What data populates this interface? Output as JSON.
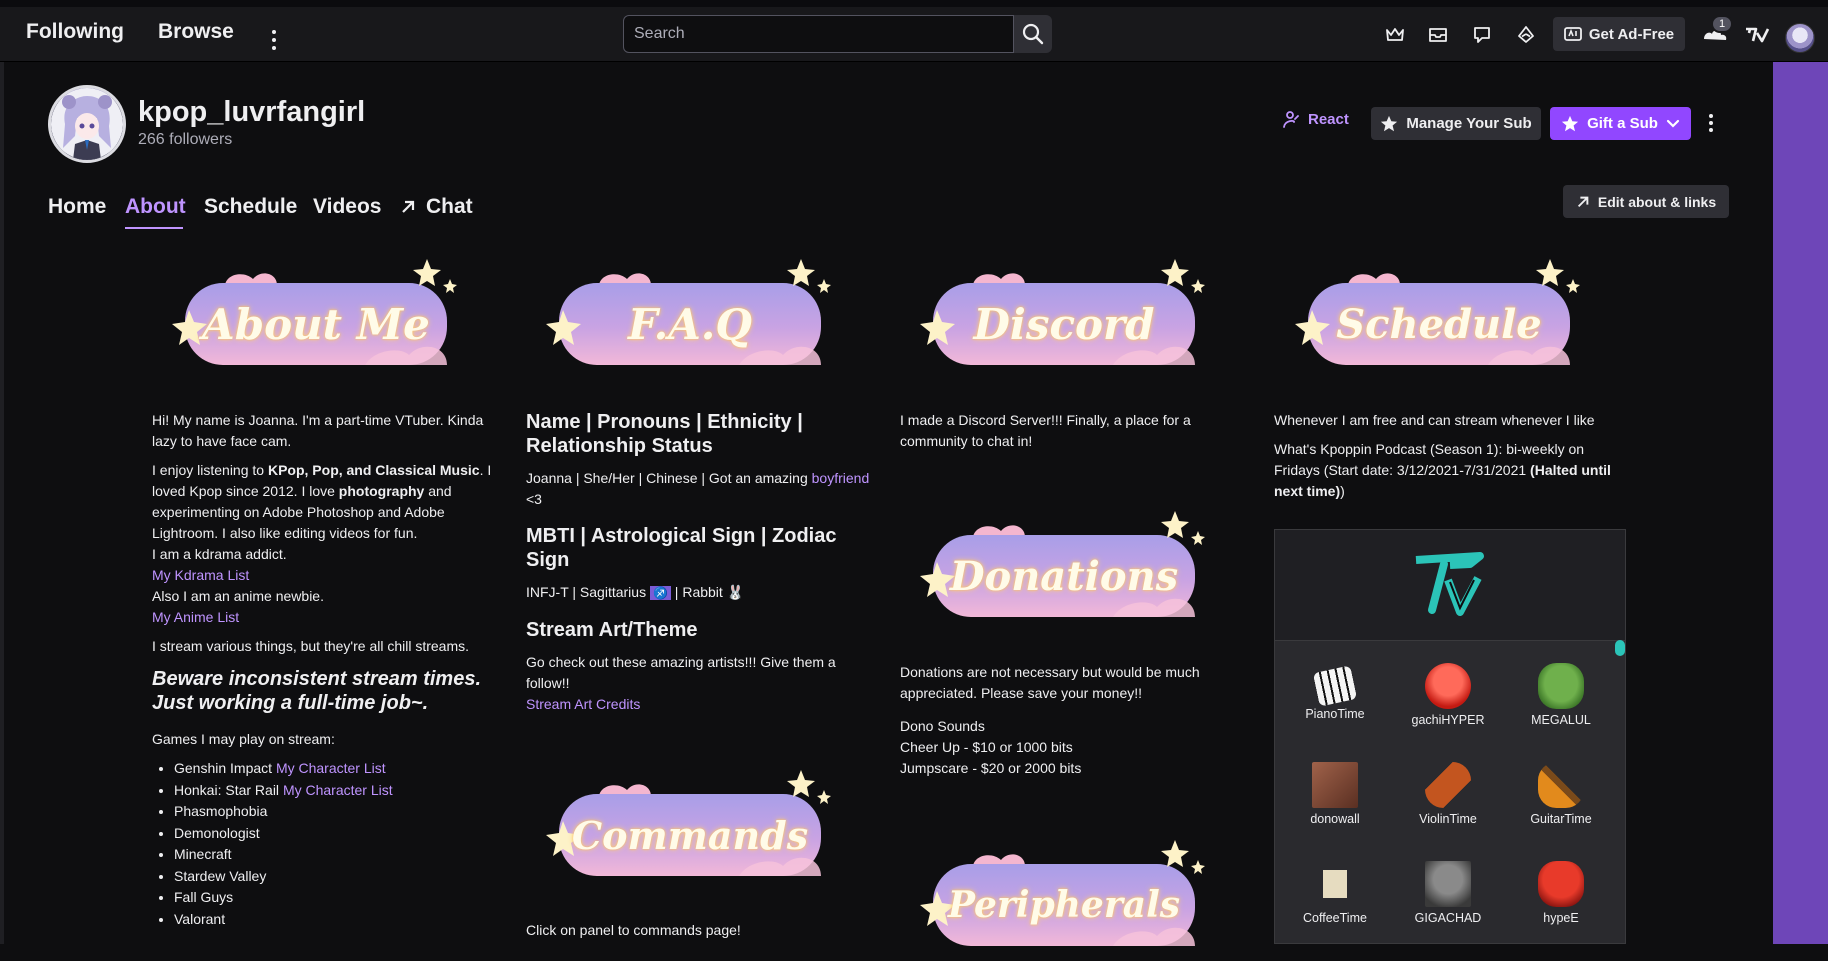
{
  "topnav": {
    "following": "Following",
    "browse": "Browse",
    "search_placeholder": "Search",
    "get_ad_free": "Get Ad-Free",
    "notification_count": "1"
  },
  "channel": {
    "name": "kpop_luvrfangirl",
    "followers": "266 followers",
    "react": "React",
    "manage_sub": "Manage Your Sub",
    "gift_sub": "Gift a Sub"
  },
  "tabs": {
    "home": "Home",
    "about": "About",
    "schedule": "Schedule",
    "videos": "Videos",
    "chat": "Chat",
    "edit": "Edit about & links"
  },
  "panels": {
    "about_me": "About Me",
    "faq": "F.A.Q",
    "discord": "Discord",
    "schedule": "Schedule",
    "donations": "Donations",
    "commands": "Commands",
    "peripherals": "Peripherals"
  },
  "about": {
    "p1": "Hi! My name is Joanna. I'm a part-time VTuber. Kinda lazy to have face cam.",
    "p2a": "I enjoy listening to ",
    "p2b": "KPop, Pop, and Classical Music",
    "p2c": ". I loved Kpop since 2012. I love ",
    "p2d": "photography",
    "p2e": " and experimenting on Adobe Photoshop and Adobe Lightroom. I also like editing videos for fun.",
    "p2f": "I am a kdrama addict.",
    "kdrama_link": "My Kdrama List",
    "p2g": "Also I am an anime newbie.",
    "anime_link": "My Anime List",
    "p3": "I stream various things, but they're all chill streams.",
    "beware": "Beware inconsistent stream times. Just working a full-time job~.",
    "games_label": "Games I may play on stream:",
    "games": [
      {
        "name": "Genshin Impact ",
        "link": "My Character List"
      },
      {
        "name": "Honkai: Star Rail ",
        "link": "My Character List"
      },
      {
        "name": "Phasmophobia",
        "link": ""
      },
      {
        "name": "Demonologist",
        "link": ""
      },
      {
        "name": "Minecraft",
        "link": ""
      },
      {
        "name": "Stardew Valley",
        "link": ""
      },
      {
        "name": "Fall Guys",
        "link": ""
      },
      {
        "name": "Valorant",
        "link": ""
      }
    ]
  },
  "faq": {
    "h1": "Name | Pronouns | Ethnicity | Relationship Status",
    "t1": "Joanna | She/Her | Chinese | Got an amazing ",
    "boyfriend": "boyfriend",
    "t1b": " <3",
    "h2": "MBTI | Astrological Sign | Zodiac Sign",
    "t2a": "INFJ-T | Sagittarius ",
    "sag_symbol": "♐",
    "t2b": " | Rabbit ",
    "rabbit_symbol": "🐰",
    "h3": "Stream Art/Theme",
    "t3": "Go check out these amazing artists!!! Give them a follow!!",
    "art_link": "Stream Art Credits",
    "commands_text": "Click on panel to commands page!"
  },
  "discord": {
    "text": "I made a Discord Server!!! Finally, a place for a community to chat in!"
  },
  "donations": {
    "text": "Donations are not necessary but would be much appreciated. Please save your money!!",
    "sounds_label": "Dono Sounds",
    "s1": "Cheer Up - $10 or 1000 bits",
    "s2": "Jumpscare - $20 or 2000 bits"
  },
  "schedule": {
    "t1": "Whenever I am free and can stream whenever I like",
    "t2": "What's Kpoppin Podcast (Season 1): bi-weekly on Fridays (Start date: 3/12/2021-7/31/2021 ",
    "t2b": "(Halted until next time)",
    "t2c": ")"
  },
  "emotes": [
    {
      "name": "PianoTime",
      "color": "#f0f0f0"
    },
    {
      "name": "gachiHYPER",
      "color": "#e0302a"
    },
    {
      "name": "MEGALUL",
      "color": "#4e8f3a"
    },
    {
      "name": "donowall",
      "color": "#7a4a3a"
    },
    {
      "name": "ViolinTime",
      "color": "#b8451f"
    },
    {
      "name": "GuitarTime",
      "color": "#e28a1c"
    },
    {
      "name": "CoffeeTime",
      "color": "#d7c9a8"
    },
    {
      "name": "GIGACHAD",
      "color": "#5c5c5c"
    },
    {
      "name": "hypeE",
      "color": "#c8201c"
    }
  ],
  "colors": {
    "accent": "#bf94ff",
    "purple_button": "#9147ff",
    "teal_logo": "#2bc4b8"
  }
}
